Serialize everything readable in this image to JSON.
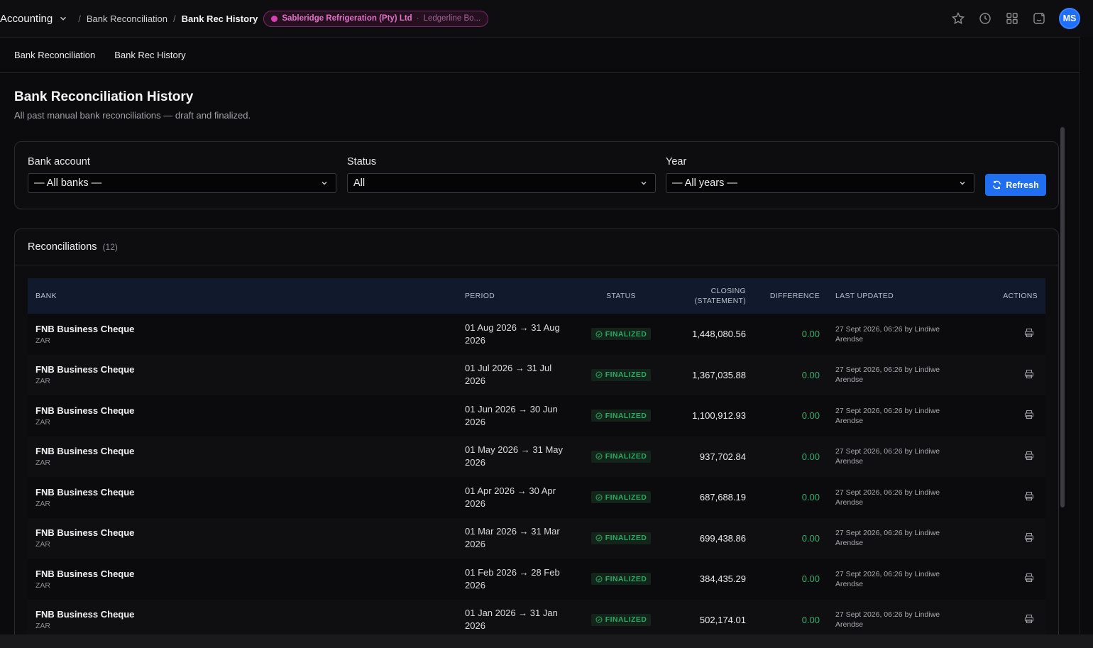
{
  "topbar": {
    "app_name": "Accounting",
    "breadcrumbs": [
      "Bank Reconciliation",
      "Bank Rec History"
    ],
    "org_name": "Sableridge Refrigeration (Pty) Ltd",
    "org_book": "Ledgerline Bo...",
    "avatar_initials": "MS",
    "icons": [
      "star-icon",
      "clock-icon",
      "grid-icon",
      "smile-icon"
    ]
  },
  "subtabs": [
    "Bank Reconciliation",
    "Bank Rec History"
  ],
  "page": {
    "title": "Bank Reconciliation History",
    "subtitle": "All past manual bank reconciliations — draft and finalized."
  },
  "filters": {
    "bank_label": "Bank account",
    "bank_value": "— All banks —",
    "status_label": "Status",
    "status_value": "All",
    "year_label": "Year",
    "year_value": "— All years —",
    "refresh_label": "Refresh"
  },
  "reconciliations": {
    "title": "Reconciliations",
    "count": "(12)",
    "columns": [
      "BANK",
      "PERIOD",
      "STATUS",
      "CLOSING (STATEMENT)",
      "DIFFERENCE",
      "LAST UPDATED",
      "ACTIONS"
    ],
    "rows": [
      {
        "bank": "FNB Business Cheque",
        "currency": "ZAR",
        "period": "01 Aug 2026 → 31 Aug 2026",
        "status": "FINALIZED",
        "closing": "1,448,080.56",
        "difference": "0.00",
        "updated": "27 Sept 2026, 06:26 by Lindiwe Arendse"
      },
      {
        "bank": "FNB Business Cheque",
        "currency": "ZAR",
        "period": "01 Jul 2026 → 31 Jul 2026",
        "status": "FINALIZED",
        "closing": "1,367,035.88",
        "difference": "0.00",
        "updated": "27 Sept 2026, 06:26 by Lindiwe Arendse"
      },
      {
        "bank": "FNB Business Cheque",
        "currency": "ZAR",
        "period": "01 Jun 2026 → 30 Jun 2026",
        "status": "FINALIZED",
        "closing": "1,100,912.93",
        "difference": "0.00",
        "updated": "27 Sept 2026, 06:26 by Lindiwe Arendse"
      },
      {
        "bank": "FNB Business Cheque",
        "currency": "ZAR",
        "period": "01 May 2026 → 31 May 2026",
        "status": "FINALIZED",
        "closing": "937,702.84",
        "difference": "0.00",
        "updated": "27 Sept 2026, 06:26 by Lindiwe Arendse"
      },
      {
        "bank": "FNB Business Cheque",
        "currency": "ZAR",
        "period": "01 Apr 2026 → 30 Apr 2026",
        "status": "FINALIZED",
        "closing": "687,688.19",
        "difference": "0.00",
        "updated": "27 Sept 2026, 06:26 by Lindiwe Arendse"
      },
      {
        "bank": "FNB Business Cheque",
        "currency": "ZAR",
        "period": "01 Mar 2026 → 31 Mar 2026",
        "status": "FINALIZED",
        "closing": "699,438.86",
        "difference": "0.00",
        "updated": "27 Sept 2026, 06:26 by Lindiwe Arendse"
      },
      {
        "bank": "FNB Business Cheque",
        "currency": "ZAR",
        "period": "01 Feb 2026 → 28 Feb 2026",
        "status": "FINALIZED",
        "closing": "384,435.29",
        "difference": "0.00",
        "updated": "27 Sept 2026, 06:26 by Lindiwe Arendse"
      },
      {
        "bank": "FNB Business Cheque",
        "currency": "ZAR",
        "period": "01 Jan 2026 → 31 Jan 2026",
        "status": "FINALIZED",
        "closing": "502,174.01",
        "difference": "0.00",
        "updated": "27 Sept 2026, 06:26 by Lindiwe Arendse"
      }
    ]
  },
  "colors": {
    "accent": "#1f6ff0",
    "finalized_text": "#2ea863",
    "finalized_bg": "#13251b",
    "org_pill": "#d63fb6"
  }
}
